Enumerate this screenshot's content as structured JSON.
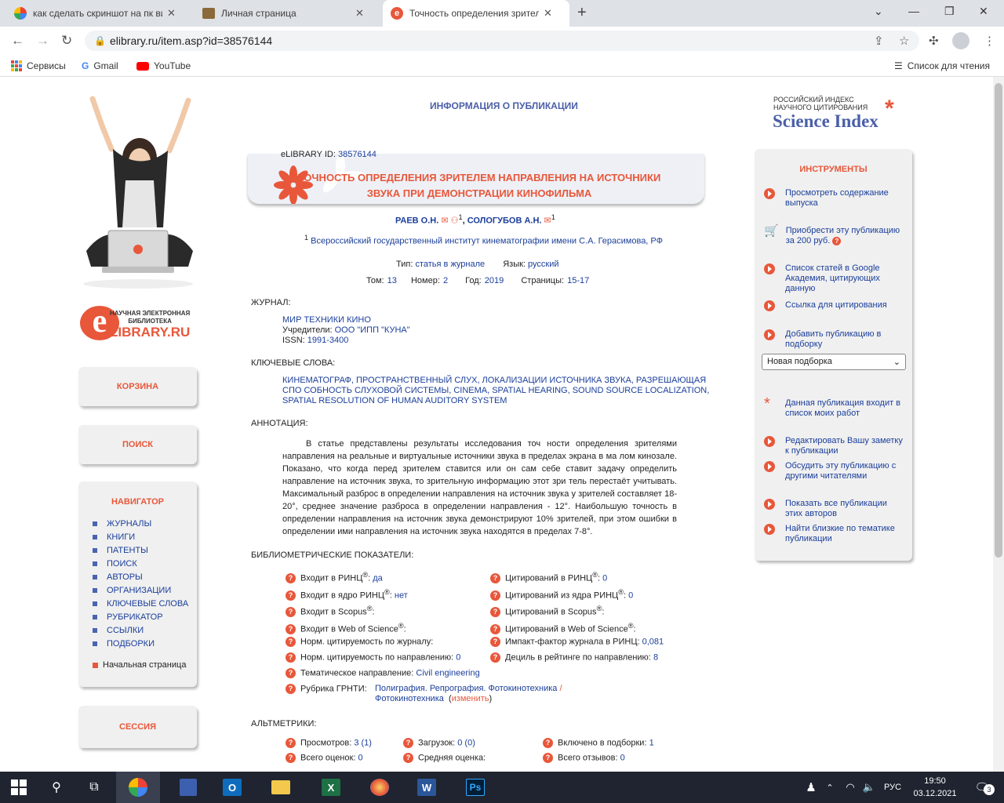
{
  "tabs": [
    {
      "title": "как сделать скриншот на пк вин"
    },
    {
      "title": "Личная страница"
    },
    {
      "title": "Точность определения зрителе"
    }
  ],
  "address": {
    "url": "elibrary.ru/item.asp?id=38576144"
  },
  "bookmarks": {
    "services": "Сервисы",
    "gmail": "Gmail",
    "youtube": "YouTube",
    "reading_list": "Список для чтения"
  },
  "logo": {
    "line1": "НАУЧНАЯ ЭЛЕКТРОННАЯ",
    "line2": "БИБЛИОТЕКА",
    "brand": "LIBRARY.RU",
    "brand_e": "e"
  },
  "sidebar": {
    "cart": "КОРЗИНА",
    "search": "ПОИСК",
    "navigator_title": "НАВИГАТОР",
    "nav_items": [
      "ЖУРНАЛЫ",
      "КНИГИ",
      "ПАТЕНТЫ",
      "ПОИСК",
      "АВТОРЫ",
      "ОРГАНИЗАЦИИ",
      "КЛЮЧЕВЫЕ СЛОВА",
      "РУБРИКАТОР",
      "ССЫЛКИ",
      "ПОДБОРКИ"
    ],
    "home": "Начальная страница",
    "session": "СЕССИЯ"
  },
  "header": {
    "title": "ИНФОРМАЦИЯ О ПУБЛИКАЦИИ"
  },
  "pub": {
    "id_label": "eLIBRARY ID:",
    "id": "38576144",
    "title1": "ТОЧНОСТЬ ОПРЕДЕЛЕНИЯ ЗРИТЕЛЕМ НАПРАВЛЕНИЯ НА ИСТОЧНИКИ",
    "title2": "ЗВУКА ПРИ ДЕМОНСТРАЦИИ КИНОФИЛЬМА",
    "author1": "РАЕВ О.Н.",
    "author2": "СОЛОГУБОВ А.Н.",
    "sup": "1",
    "affiliation": "Всероссийский государственный институт кинематографии имени С.А. Герасимова, РФ",
    "type_label": "Тип:",
    "type": "статья в журнале",
    "lang_label": "Язык:",
    "lang": "русский",
    "vol_label": "Том:",
    "vol": "13",
    "num_label": "Номер:",
    "num": "2",
    "year_label": "Год:",
    "year": "2019",
    "pages_label": "Страницы:",
    "pages": "15-17"
  },
  "journal": {
    "label": "ЖУРНАЛ:",
    "name": "МИР ТЕХНИКИ КИНО",
    "founders_label": "Учредители:",
    "founders": "ООО \"ИПП \"КУНА\"",
    "issn_label": "ISSN:",
    "issn": "1991-3400"
  },
  "keywords": {
    "label": "КЛЮЧЕВЫЕ СЛОВА:",
    "line1": "КИНЕМАТОГРАФ, ПРОСТРАНСТВЕННЫЙ СЛУХ, ЛОКАЛИЗАЦИИ ИСТОЧНИКА ЗВУКА, РАЗРЕШАЮЩАЯ",
    "line2": "СПО СОБНОСТЬ СЛУХОВОЙ СИСТЕМЫ, CINEMA, SPATIAL HEARING, SOUND SOURCE LOCALIZATION,",
    "line3": "SPATIAL RESOLUTION OF HUMAN AUDITORY SYSTEM"
  },
  "abstract": {
    "label": "АННОТАЦИЯ:",
    "text": "В статье представлены результаты исследования точ ности определения зрителями направления на реальные и виртуальные источники звука в пределах экрана в ма лом кинозале. Показано, что когда перед зрителем ставится или он сам себе ставит задачу определить направление на источник звука, то зрительную информацию этот зри тель перестаёт учитывать. Максимальный разброс в определении направления на источник звука у зрителей составляет 18-20°, среднее значение разброса в определении направления - 12°. Наибольшую точность в определении направления на источник звука демонстрируют 10% зрителей, при этом ошибки в определении ими направления на источник звука находятся в пределах 7-8°."
  },
  "biblio": {
    "label": "БИБЛИОМЕТРИЧЕСКИЕ ПОКАЗАТЕЛИ:",
    "rinc_in": "Входит в РИНЦ",
    "rinc_in_val": "да",
    "rinc_core": "Входит в ядро РИНЦ",
    "rinc_core_val": "нет",
    "scopus_in": "Входит в Scopus",
    "wos_in": "Входит в Web of Science",
    "norm_journal": "Норм. цитируемость по журналу:",
    "norm_dir": "Норм. цитируемость по направлению:",
    "norm_dir_val": "0",
    "theme": "Тематическое направление:",
    "theme_val": "Civil engineering",
    "grnti": "Рубрика ГРНТИ:",
    "grnti_val1": "Полиграфия. Репрография. Фотокинотехника",
    "grnti_slash": "/",
    "grnti_val2": "Фотокинотехника",
    "change": "изменить",
    "cit_rinc": "Цитирований в РИНЦ",
    "cit_rinc_val": "0",
    "cit_core": "Цитирований из ядра РИНЦ",
    "cit_core_val": "0",
    "cit_scopus": "Цитирований в Scopus",
    "cit_wos": "Цитирований в Web of Science",
    "impact": "Импакт-фактор журнала в РИНЦ:",
    "impact_val": "0,081",
    "decile": "Дециль в рейтинге по направлению:",
    "decile_val": "8",
    "reg": "®"
  },
  "altmetrics": {
    "label": "АЛЬТМЕТРИКИ:",
    "views": "Просмотров:",
    "views_val": "3 (1)",
    "downloads": "Загрузок:",
    "downloads_val": "0 (0)",
    "included": "Включено в подборки:",
    "included_val": "1",
    "ratings": "Всего оценок:",
    "ratings_val": "0",
    "avg": "Средняя оценка:",
    "reviews": "Всего отзывов:",
    "reviews_val": "0"
  },
  "science_index": {
    "line1": "РОССИЙСКИЙ ИНДЕКС",
    "line2": "НАУЧНОГО ЦИТИРОВАНИЯ",
    "brand": "Science Index"
  },
  "tools": {
    "title": "ИНСТРУМЕНТЫ",
    "items": [
      "Просмотреть содержание выпуска",
      "Приобрести эту публикацию за 200 руб.",
      "Список статей в Google Академия, цитирующих данную",
      "Ссылка для цитирования",
      "Добавить публикацию в подборку",
      "Данная публикация входит в список моих работ",
      "Редактировать Вашу заметку к публикации",
      "Обсудить эту публикацию с другими читателями",
      "Показать все публикации этих авторов",
      "Найти близкие по тематике публикации"
    ],
    "select_value": "Новая подборка"
  },
  "taskbar": {
    "lang": "РУС",
    "time": "19:50",
    "date": "03.12.2021",
    "notif_count": "3"
  },
  "colors": {
    "accent": "#e8573a",
    "link": "#1a3e9a",
    "panel": "#f0f0f0"
  }
}
